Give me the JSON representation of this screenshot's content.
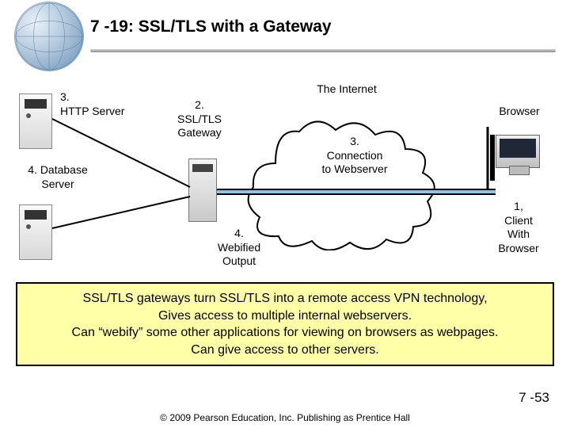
{
  "title": "7 -19: SSL/TLS with a Gateway",
  "internet_label": "The Internet",
  "nodes": {
    "http_server": "3.\nHTTP Server",
    "db_server": "4. Database\nServer",
    "gateway": "2.\nSSL/TLS\nGateway",
    "webified": "4.\nWebified\nOutput",
    "conn_web": "3.\nConnection\nto Webserver",
    "browser": "Browser",
    "client": "1,\nClient\nWith\nBrowser"
  },
  "info_lines": [
    "SSL/TLS gateways turn SSL/TLS into a remote access VPN technology,",
    "Gives access to multiple internal webservers.",
    "Can “webify” some other applications for viewing on browsers as webpages.",
    "Can give access to other servers."
  ],
  "footer": "© 2009 Pearson Education, Inc.  Publishing as Prentice Hall",
  "page": "7 -53"
}
